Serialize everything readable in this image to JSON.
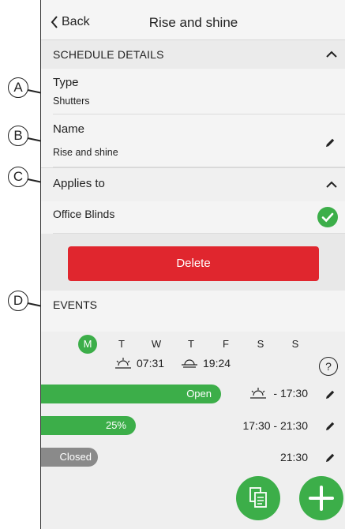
{
  "header": {
    "back_label": "Back",
    "title": "Rise and shine"
  },
  "schedule_details": {
    "label": "SCHEDULE DETAILS",
    "type": {
      "label": "Type",
      "value": "Shutters"
    },
    "name": {
      "label": "Name",
      "value": "Rise and shine"
    }
  },
  "applies_to": {
    "label": "Applies to",
    "item": "Office Blinds"
  },
  "delete_label": "Delete",
  "events": {
    "label": "EVENTS",
    "days": [
      "M",
      "T",
      "W",
      "T",
      "F",
      "S",
      "S"
    ],
    "sunrise": "07:31",
    "sunset": "19:24",
    "help": "?",
    "rows": [
      {
        "label": "Open",
        "level": 1.0,
        "time": "- 17:30"
      },
      {
        "label": "25%",
        "level": 0.25,
        "time": "17:30 - 21:30"
      },
      {
        "label": "Closed",
        "level": 0.0,
        "time": "21:30"
      }
    ]
  },
  "callouts": [
    "A",
    "B",
    "C",
    "D"
  ],
  "colors": {
    "accent": "#3cae49",
    "danger": "#e0262e",
    "closed": "#8a8a8a"
  }
}
